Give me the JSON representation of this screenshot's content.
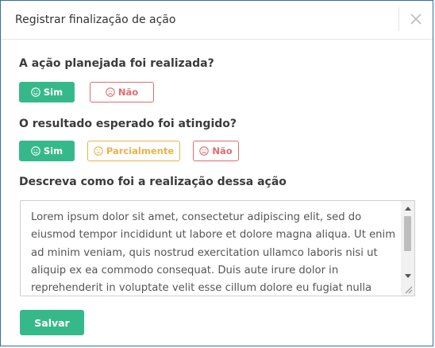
{
  "modal": {
    "title": "Registrar finalização de ação",
    "close_icon": "close-icon"
  },
  "questions": {
    "q1": {
      "label": "A ação planejada foi realizada?",
      "options": [
        {
          "label": "Sim",
          "icon": "smile-icon",
          "selected": true
        },
        {
          "label": "Não",
          "icon": "frown-icon",
          "selected": false
        }
      ]
    },
    "q2": {
      "label": "O resultado esperado foi atingido?",
      "options": [
        {
          "label": "Sim",
          "icon": "smile-icon",
          "selected": true
        },
        {
          "label": "Parcialmente",
          "icon": "neutral-face-icon",
          "selected": false
        },
        {
          "label": "Não",
          "icon": "frown-icon",
          "selected": false
        }
      ]
    },
    "q3": {
      "label": "Descreva como foi a realização dessa ação",
      "value": "Lorem ipsum dolor sit amet, consectetur adipiscing elit, sed do eiusmod tempor incididunt ut labore et dolore magna aliqua. Ut enim ad minim veniam, quis nostrud exercitation ullamco laboris nisi ut aliquip ex ea commodo consequat. Duis aute irure dolor in reprehenderit in voluptate velit esse cillum dolore eu fugiat nulla pariatur. Excepteur sint occaecat cupidatat non"
    }
  },
  "actions": {
    "save_label": "Salvar"
  },
  "colors": {
    "success": "#36b98a",
    "danger": "#e06c6c",
    "warning": "#e8b34a",
    "border": "#2f6fae"
  }
}
